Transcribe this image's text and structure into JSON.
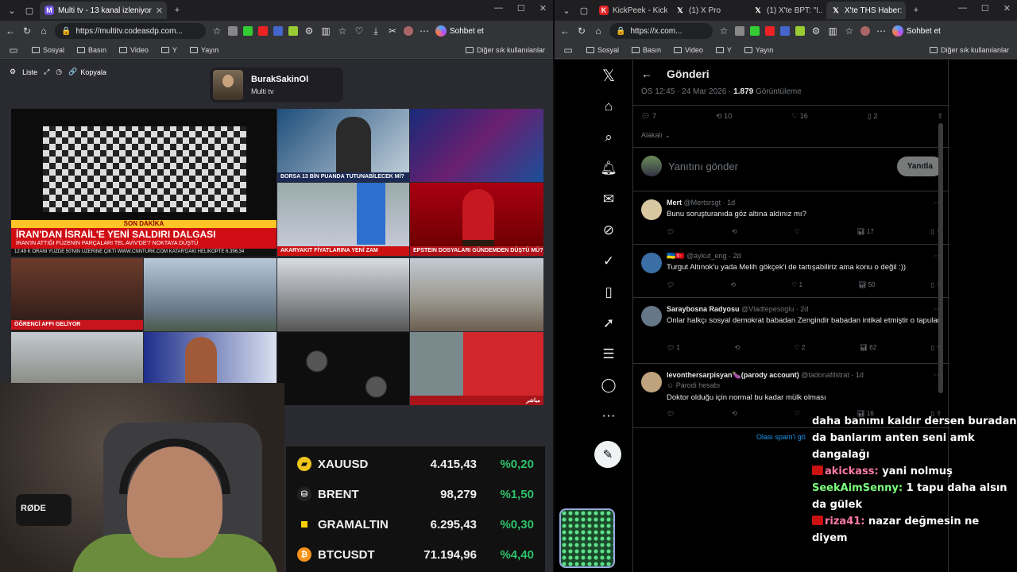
{
  "left_window": {
    "tab_title": "Multi tv - 13 kanal izleniyor",
    "url": "https://multitv.codeasdp.com...",
    "copilot": "Sohbet et",
    "bookmarks": [
      "Sosyal",
      "Basın",
      "Video",
      "Y",
      "Yayın"
    ],
    "other_bookmarks": "Diğer sık kullanılanlar"
  },
  "multitv": {
    "list_label": "Liste",
    "copy_label": "Kopyala",
    "profile_name": "BurakSakinOl",
    "profile_sub": "Multi tv",
    "cells": {
      "son_dakika": "SON DAKİKA",
      "main_headline": "İRAN'DAN İSRAİL'E YENİ SALDIRI DALGASI",
      "main_sub": "İRAN'IN ATTIĞI FÜZENİN PARÇALARI TEL AVİV'DE'7 NOKTAYA DÜŞTÜ",
      "main_ticker": "12:49  K ORANI YÜZDE 50'NİN ÜZERİNE ÇIKTI  WWW.CNNTURK.COM  KATAR'DAKİ HELİKOPTE  6.396,34",
      "borsa": "BORSA 13 BİN PUANDA TUTUNABİLECEK Mİ?",
      "akaryakit": "AKARYAKIT FİYATLARINA YENİ ZAM",
      "epstein": "EPSTEIN DOSYALARI GÜNDEMDEN DÜŞTÜ MÜ?",
      "ogrenci": "ÖĞRENCİ AFFI GELİYOR"
    },
    "tickers": [
      {
        "symbol": "XAUUSD",
        "value": "4.415,43",
        "pct": "%0,20",
        "color": "#f0c419",
        "icon": "gold-icon"
      },
      {
        "symbol": "BRENT",
        "value": "98,279",
        "pct": "%1,50",
        "color": "#dddddd",
        "icon": "oil-icon"
      },
      {
        "symbol": "GRAMALTIN",
        "value": "6.295,43",
        "pct": "%0,30",
        "color": "#f5d000",
        "icon": "gram-gold-icon"
      },
      {
        "symbol": "BTCUSDT",
        "value": "71.194,96",
        "pct": "%4,40",
        "color": "#f7931a",
        "icon": "bitcoin-icon"
      }
    ],
    "webcam_mic_label": "RØDE"
  },
  "right_window": {
    "tabs": [
      "KickPeek - Kick...",
      "(1) X Pro",
      "(1) X'te BPT: \"I...",
      "X'te THS Haber:"
    ],
    "url": "https://x.com...",
    "copilot": "Sohbet et",
    "bookmarks": [
      "Sosyal",
      "Basın",
      "Video",
      "Y",
      "Yayın"
    ],
    "other_bookmarks": "Diğer sık kullanılanlar"
  },
  "x": {
    "header": "Gönderi",
    "meta_time": "ÖS 12:45 · 24 Mar 2026 · ",
    "meta_views": "1.879",
    "meta_views_label": " Görüntüleme",
    "counts": {
      "replies": "7",
      "reposts": "10",
      "likes": "16",
      "bookmarks": "2"
    },
    "relevant": "Alakalı",
    "reply_placeholder": "Yanıtını gönder",
    "reply_button": "Yanıtla",
    "tweets": [
      {
        "name": "Mert",
        "handle": "@Mertsrsgt · 1d",
        "text": "Bunu soruşturanıda göz altına aldınız mı?",
        "parody": "",
        "views": "17",
        "likes": "",
        "replies": "",
        "avatar": "#d9c7a2"
      },
      {
        "name": "🇺🇦🇹🇷",
        "handle": "@aykut_eng · 2d",
        "text": "Turgut Altınok'u yada Melih gökçek'i de tartışabiliriz ama konu o değil :))",
        "parody": "",
        "views": "50",
        "likes": "1",
        "replies": "",
        "avatar": "#3a6ea5"
      },
      {
        "name": "Saraybosna Radyosu",
        "handle": "@Vladtepesoglu · 2d",
        "text": "Onlar halkçı sosyal demokrat  babadan Zengindir babadan intikal etmiştir o tapular",
        "parody": "",
        "views": "62",
        "likes": "2",
        "replies": "1",
        "avatar": "#667788"
      },
      {
        "name": "levonthersarpisyan🍆(parody account)",
        "handle": "@tadonafilstrat · 1d",
        "text": "Doktor olduğu için normal bu kadar mülk olması",
        "parody": "Parodi hesabı",
        "views": "16",
        "likes": "",
        "replies": "",
        "avatar": "#bfa27e"
      }
    ],
    "spam": "Olası spam'i gö"
  },
  "chat": [
    {
      "user": "",
      "color": "#ffffff",
      "msg": "daha banımı kaldır dersen buradan da banlarım anten seni amk dangalağı",
      "badge": false
    },
    {
      "user": "akickass:",
      "color": "#ff7aa8",
      "msg": " yani nolmuş",
      "badge": true
    },
    {
      "user": "SeekAimSenny:",
      "color": "#7cff7c",
      "msg": " 1 tapu daha alsın da gülek",
      "badge": false
    },
    {
      "user": "riza41:",
      "color": "#ff7aa8",
      "msg": " nazar değmesin ne diyem",
      "badge": true
    }
  ]
}
